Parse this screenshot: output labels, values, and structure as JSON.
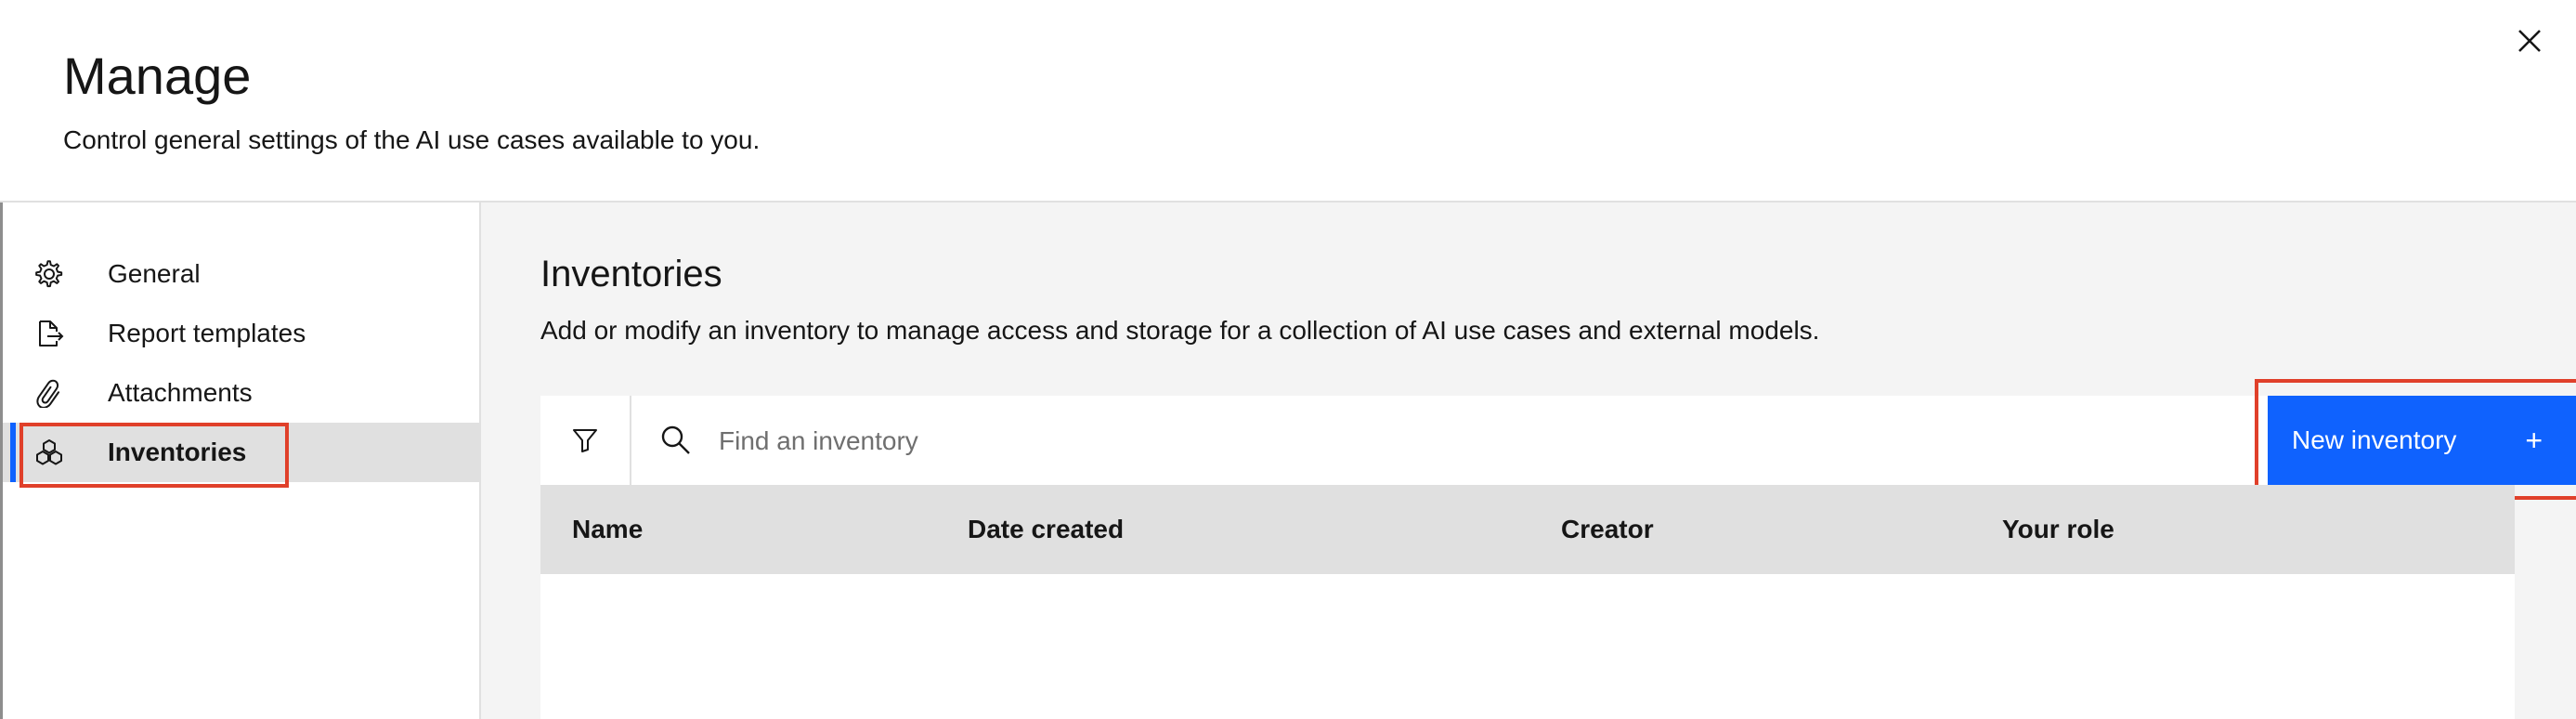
{
  "header": {
    "title": "Manage",
    "subtitle": "Control general settings of the AI use cases available to you.",
    "close_icon": "close-icon"
  },
  "sidebar": {
    "items": [
      {
        "label": "General",
        "icon": "gear-icon",
        "active": false
      },
      {
        "label": "Report templates",
        "icon": "document-export-icon",
        "active": false
      },
      {
        "label": "Attachments",
        "icon": "paperclip-icon",
        "active": false
      },
      {
        "label": "Inventories",
        "icon": "cube-stack-icon",
        "active": true
      }
    ]
  },
  "main": {
    "title": "Inventories",
    "description": "Add or modify an inventory to manage access and storage for a collection of AI use cases and external models.",
    "search": {
      "placeholder": "Find an inventory",
      "value": ""
    },
    "new_button": {
      "label": "New inventory",
      "icon": "+"
    },
    "table": {
      "columns": [
        "Name",
        "Date created",
        "Creator",
        "Your role"
      ],
      "rows": []
    }
  },
  "colors": {
    "accent": "#0f62fe",
    "highlight": "#e0402a",
    "sidebar_active_bg": "#e0e0e0",
    "main_bg": "#f4f4f4"
  }
}
